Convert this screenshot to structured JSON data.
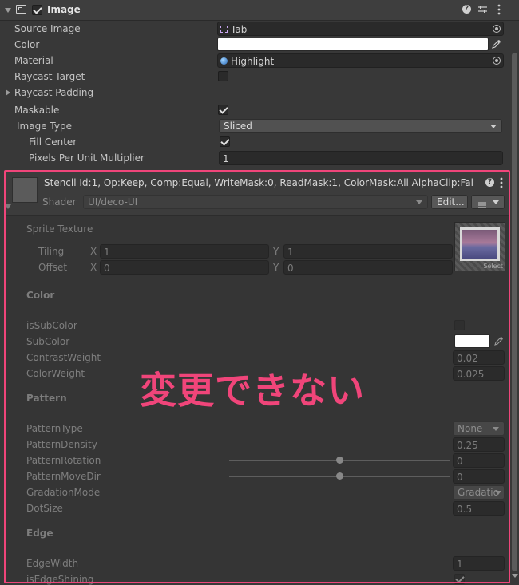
{
  "component": {
    "title": "Image",
    "enabled": true
  },
  "props": {
    "source_image": {
      "label": "Source Image",
      "value": "Tab"
    },
    "color": {
      "label": "Color",
      "value_hex": "#ffffff"
    },
    "material": {
      "label": "Material",
      "value": "Highlight"
    },
    "raycast_target": {
      "label": "Raycast Target",
      "checked": false
    },
    "raycast_padding": {
      "label": "Raycast Padding"
    },
    "maskable": {
      "label": "Maskable",
      "checked": true
    },
    "image_type": {
      "label": "Image Type",
      "value": "Sliced"
    },
    "fill_center": {
      "label": "Fill Center",
      "checked": true
    },
    "ppu": {
      "label": "Pixels Per Unit Multiplier",
      "value": "1"
    }
  },
  "material_panel": {
    "title": "Stencil Id:1, Op:Keep, Comp:Equal, WriteMask:0, ReadMask:1, ColorMask:All AlphaClip:Fal",
    "shader_label": "Shader",
    "shader_value": "UI/deco-UI",
    "edit_label": "Edit...",
    "sprite_texture": "Sprite Texture",
    "tiling": {
      "label": "Tiling",
      "x": "1",
      "y": "1"
    },
    "offset": {
      "label": "Offset",
      "x": "0",
      "y": "0"
    },
    "axis_x": "X",
    "axis_y": "Y",
    "select_label": "Select",
    "sections": {
      "color": "Color",
      "pattern": "Pattern",
      "edge": "Edge"
    },
    "is_sub_color": {
      "label": "isSubColor",
      "checked": false
    },
    "sub_color": {
      "label": "SubColor",
      "value_hex": "#ffffff"
    },
    "contrast_weight": {
      "label": "ContrastWeight",
      "value": "0.02"
    },
    "color_weight": {
      "label": "ColorWeight",
      "value": "0.025"
    },
    "pattern_type": {
      "label": "PatternType",
      "value": "None"
    },
    "pattern_density": {
      "label": "PatternDensity",
      "value": "0.25"
    },
    "pattern_rotation": {
      "label": "PatternRotation",
      "value": "0",
      "slider_fraction": 0.5
    },
    "pattern_move_dir": {
      "label": "PatternMoveDir",
      "value": "0",
      "slider_fraction": 0.5
    },
    "gradation_mode": {
      "label": "GradationMode",
      "value": "Gradatio"
    },
    "dot_size": {
      "label": "DotSize",
      "value": "0.5"
    },
    "edge_width": {
      "label": "EdgeWidth",
      "value": "1"
    },
    "is_edge_shining": {
      "label": "isEdgeShining",
      "checked": true
    }
  },
  "annotation": {
    "text": "変更できない",
    "color": "#f0457a"
  }
}
